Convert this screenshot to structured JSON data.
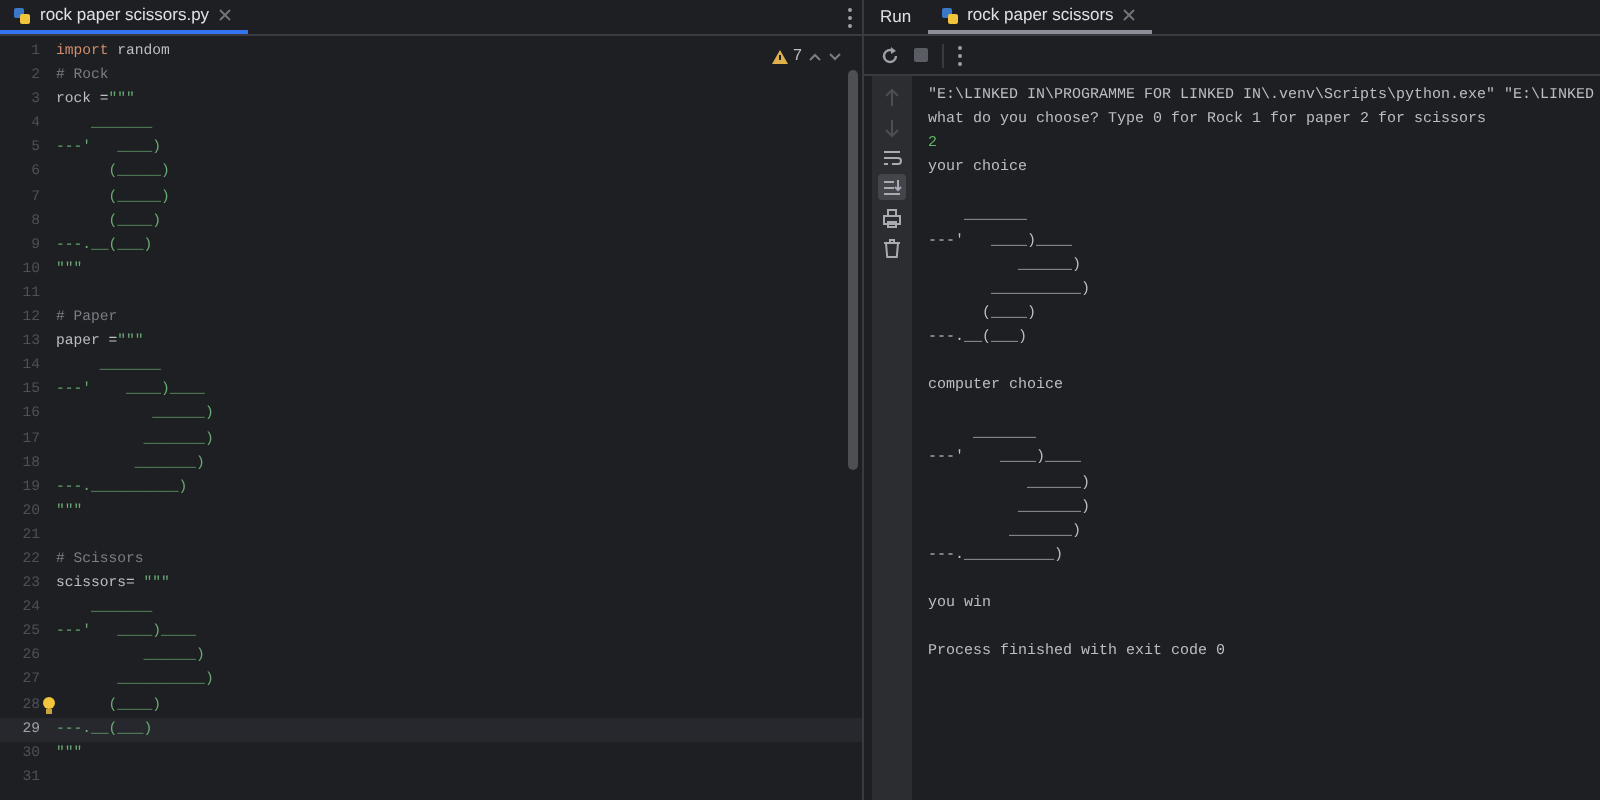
{
  "editor": {
    "tabs": [
      {
        "label": "rock paper scissors.py",
        "selected": true
      }
    ],
    "inspections": {
      "count": "7"
    },
    "lines": [
      {
        "number": "1",
        "current": false,
        "hint": false,
        "segments": [
          {
            "kind": "keyword",
            "text": "import"
          },
          {
            "kind": "plain",
            "text": " random"
          }
        ]
      },
      {
        "number": "2",
        "current": false,
        "hint": false,
        "segments": [
          {
            "kind": "comment",
            "text": "# Rock"
          }
        ]
      },
      {
        "number": "3",
        "current": false,
        "hint": false,
        "segments": [
          {
            "kind": "plain",
            "text": "rock ="
          },
          {
            "kind": "string",
            "text": "\"\"\""
          }
        ]
      },
      {
        "number": "4",
        "current": false,
        "hint": false,
        "segments": [
          {
            "kind": "string",
            "text": "    _______"
          }
        ]
      },
      {
        "number": "5",
        "current": false,
        "hint": false,
        "segments": [
          {
            "kind": "string",
            "text": "---'   ____)"
          }
        ]
      },
      {
        "number": "6",
        "current": false,
        "hint": false,
        "segments": [
          {
            "kind": "string",
            "text": "      (_____)"
          }
        ]
      },
      {
        "number": "7",
        "current": false,
        "hint": false,
        "segments": [
          {
            "kind": "string",
            "text": "      (_____)"
          }
        ]
      },
      {
        "number": "8",
        "current": false,
        "hint": false,
        "segments": [
          {
            "kind": "string",
            "text": "      (____)"
          }
        ]
      },
      {
        "number": "9",
        "current": false,
        "hint": false,
        "segments": [
          {
            "kind": "string",
            "text": "---.__(___)"
          }
        ]
      },
      {
        "number": "10",
        "current": false,
        "hint": false,
        "segments": [
          {
            "kind": "string",
            "text": "\"\"\""
          }
        ]
      },
      {
        "number": "11",
        "current": false,
        "hint": false
      },
      {
        "number": "12",
        "current": false,
        "hint": false,
        "segments": [
          {
            "kind": "comment",
            "text": "# Paper"
          }
        ]
      },
      {
        "number": "13",
        "current": false,
        "hint": false,
        "segments": [
          {
            "kind": "plain",
            "text": "paper ="
          },
          {
            "kind": "string",
            "text": "\"\"\""
          }
        ]
      },
      {
        "number": "14",
        "current": false,
        "hint": false,
        "segments": [
          {
            "kind": "string",
            "text": "     _______"
          }
        ]
      },
      {
        "number": "15",
        "current": false,
        "hint": false,
        "segments": [
          {
            "kind": "string",
            "text": "---'    ____)____"
          }
        ]
      },
      {
        "number": "16",
        "current": false,
        "hint": false,
        "segments": [
          {
            "kind": "string",
            "text": "           ______)"
          }
        ]
      },
      {
        "number": "17",
        "current": false,
        "hint": false,
        "segments": [
          {
            "kind": "string",
            "text": "          _______)"
          }
        ]
      },
      {
        "number": "18",
        "current": false,
        "hint": false,
        "segments": [
          {
            "kind": "string",
            "text": "         _______)"
          }
        ]
      },
      {
        "number": "19",
        "current": false,
        "hint": false,
        "segments": [
          {
            "kind": "string",
            "text": "---.__________)"
          }
        ]
      },
      {
        "number": "20",
        "current": false,
        "hint": false,
        "segments": [
          {
            "kind": "string",
            "text": "\"\"\""
          }
        ]
      },
      {
        "number": "21",
        "current": false,
        "hint": false
      },
      {
        "number": "22",
        "current": false,
        "hint": false,
        "segments": [
          {
            "kind": "comment",
            "text": "# Scissors"
          }
        ]
      },
      {
        "number": "23",
        "current": false,
        "hint": false,
        "segments": [
          {
            "kind": "plain",
            "text": "scissors= "
          },
          {
            "kind": "string",
            "text": "\"\"\""
          }
        ]
      },
      {
        "number": "24",
        "current": false,
        "hint": false,
        "segments": [
          {
            "kind": "string",
            "text": "    _______"
          }
        ]
      },
      {
        "number": "25",
        "current": false,
        "hint": false,
        "segments": [
          {
            "kind": "string",
            "text": "---'   ____)____"
          }
        ]
      },
      {
        "number": "26",
        "current": false,
        "hint": false,
        "segments": [
          {
            "kind": "string",
            "text": "          ______)"
          }
        ]
      },
      {
        "number": "27",
        "current": false,
        "hint": false,
        "segments": [
          {
            "kind": "string",
            "text": "       __________)"
          }
        ]
      },
      {
        "number": "28",
        "current": false,
        "hint": true,
        "segments": [
          {
            "kind": "string",
            "text": "      (____)"
          }
        ]
      },
      {
        "number": "29",
        "current": true,
        "hint": false,
        "segments": [
          {
            "kind": "string",
            "text": "---.__(___)"
          }
        ]
      },
      {
        "number": "30",
        "current": false,
        "hint": false,
        "segments": [
          {
            "kind": "string",
            "text": "\"\"\""
          }
        ]
      },
      {
        "number": "31",
        "current": false,
        "hint": false
      }
    ]
  },
  "run": {
    "title": "Run",
    "tabs": [
      {
        "label": "rock paper scissors",
        "selected": true
      }
    ],
    "side_tools": [
      {
        "kind": "up",
        "disabled": true,
        "selected": false
      },
      {
        "kind": "down",
        "disabled": true,
        "selected": false
      },
      {
        "kind": "wrap",
        "disabled": false,
        "selected": false
      },
      {
        "kind": "scroll-end",
        "disabled": false,
        "selected": true
      },
      {
        "kind": "print",
        "disabled": false,
        "selected": false
      },
      {
        "kind": "trash",
        "disabled": false,
        "selected": false
      }
    ],
    "console": [
      {
        "kind": "output",
        "text": "\"E:\\LINKED IN\\PROGRAMME FOR LINKED IN\\.venv\\Scripts\\python.exe\" \"E:\\LINKED"
      },
      {
        "kind": "output",
        "text": "what do you choose? Type 0 for Rock 1 for paper 2 for scissors"
      },
      {
        "kind": "input",
        "text": "2"
      },
      {
        "kind": "output",
        "text": "your choice"
      },
      {
        "kind": "output"
      },
      {
        "kind": "output",
        "text": "    _______"
      },
      {
        "kind": "output",
        "text": "---'   ____)____"
      },
      {
        "kind": "output",
        "text": "          ______)"
      },
      {
        "kind": "output",
        "text": "       __________)"
      },
      {
        "kind": "output",
        "text": "      (____)"
      },
      {
        "kind": "output",
        "text": "---.__(___)"
      },
      {
        "kind": "output"
      },
      {
        "kind": "output",
        "text": "computer choice"
      },
      {
        "kind": "output"
      },
      {
        "kind": "output",
        "text": "     _______"
      },
      {
        "kind": "output",
        "text": "---'    ____)____"
      },
      {
        "kind": "output",
        "text": "           ______)"
      },
      {
        "kind": "output",
        "text": "          _______)"
      },
      {
        "kind": "output",
        "text": "         _______)"
      },
      {
        "kind": "output",
        "text": "---.__________)"
      },
      {
        "kind": "output"
      },
      {
        "kind": "output",
        "text": "you win"
      },
      {
        "kind": "output"
      },
      {
        "kind": "output",
        "text": "Process finished with exit code 0"
      }
    ]
  }
}
